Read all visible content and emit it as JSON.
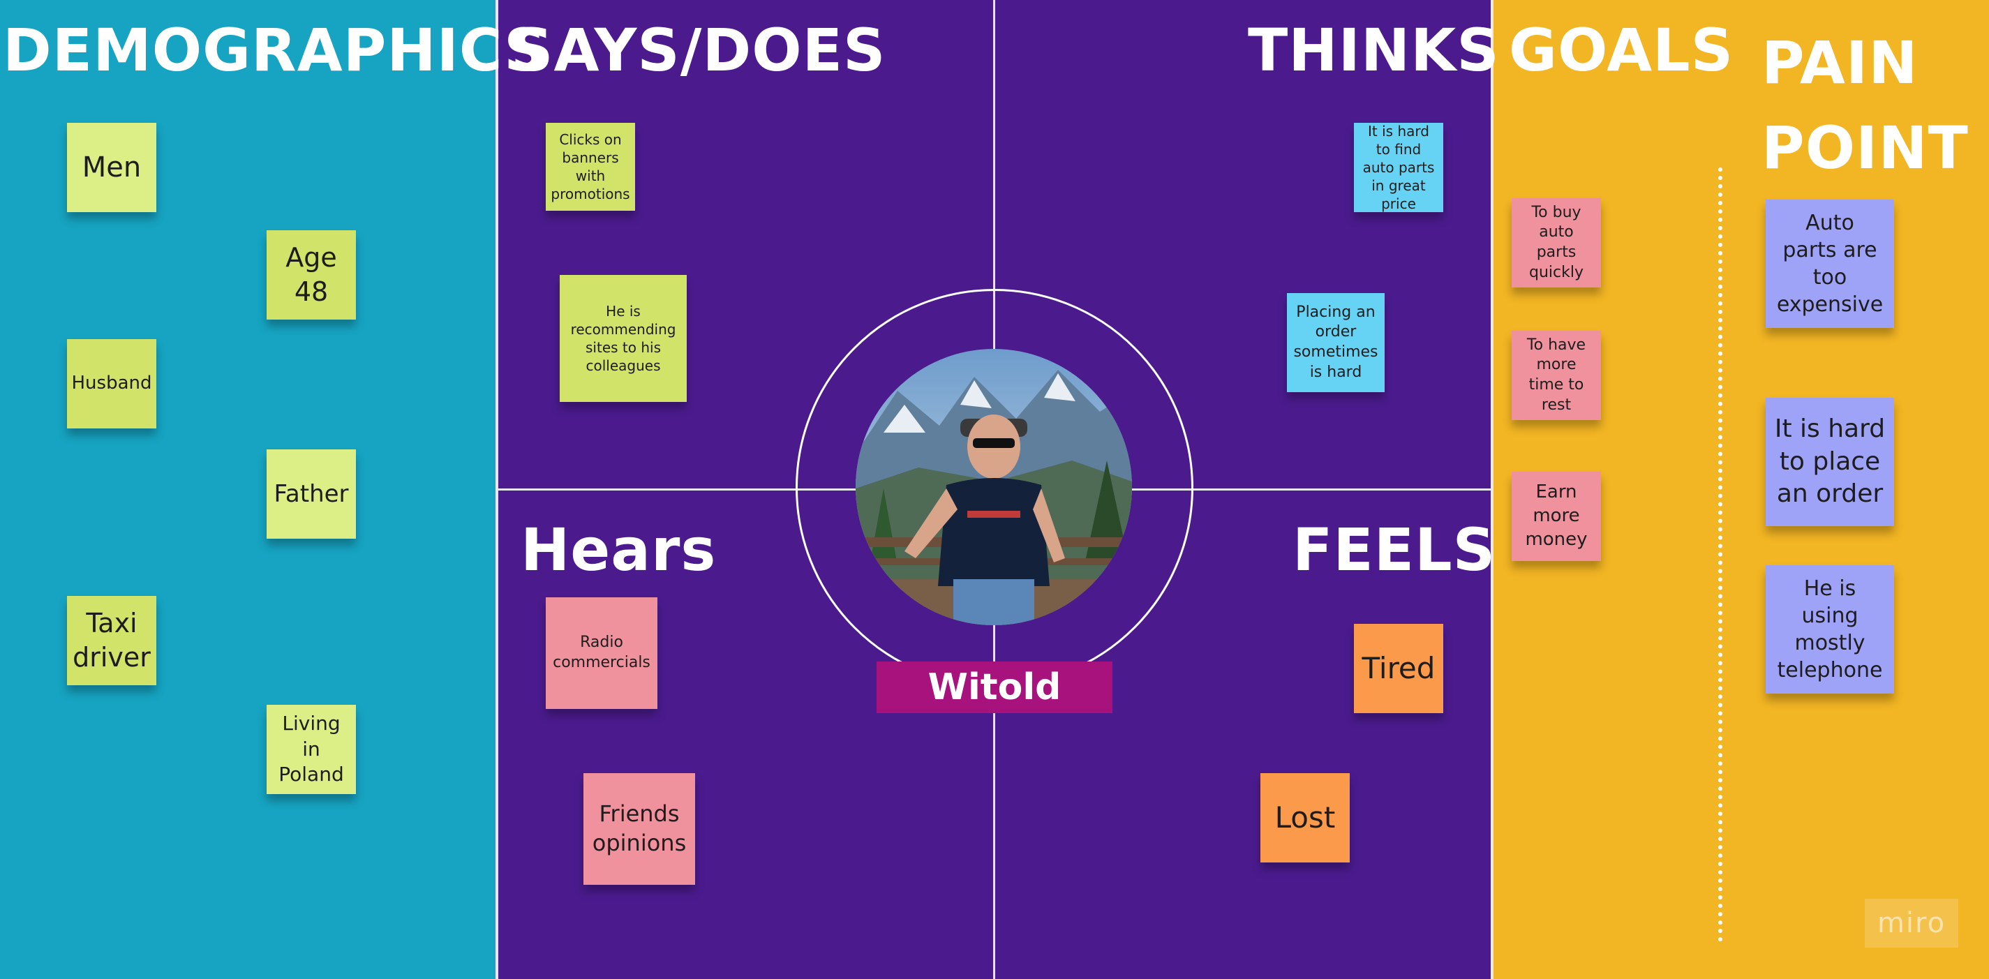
{
  "sections": {
    "demographics": "DEMOGRAPHICS",
    "says_does": "SAYS/DOES",
    "thinks": "THINKS",
    "hears": "Hears",
    "feels": "FEELS",
    "goals": "GOALS",
    "pain_point": "PAIN POINT"
  },
  "persona": {
    "name": "Witold"
  },
  "demographics_notes": [
    "Men",
    "Age 48",
    "Husband",
    "Father",
    "Taxi driver",
    "Living in Poland"
  ],
  "says_does_notes": [
    "Clicks on banners with promotions",
    "He is recommending sites to his colleagues"
  ],
  "thinks_notes": [
    "It is hard to find auto parts in great price",
    "Placing an order sometimes is hard"
  ],
  "hears_notes": [
    "Radio commercials",
    "Friends opinions"
  ],
  "feels_notes": [
    "Tired",
    "Lost"
  ],
  "goals_notes": [
    "To buy auto parts quickly",
    "To have more time to rest",
    "Earn more money"
  ],
  "pain_notes": [
    "Auto parts are too expensive",
    "It is hard to place an order",
    "He is using mostly telephone"
  ],
  "watermark": "miro",
  "colors": {
    "demographics_bg": "#16a4c2",
    "center_bg": "#4b1b8e",
    "goals_bg": "#f2b523",
    "name_bar": "#a7127d"
  }
}
